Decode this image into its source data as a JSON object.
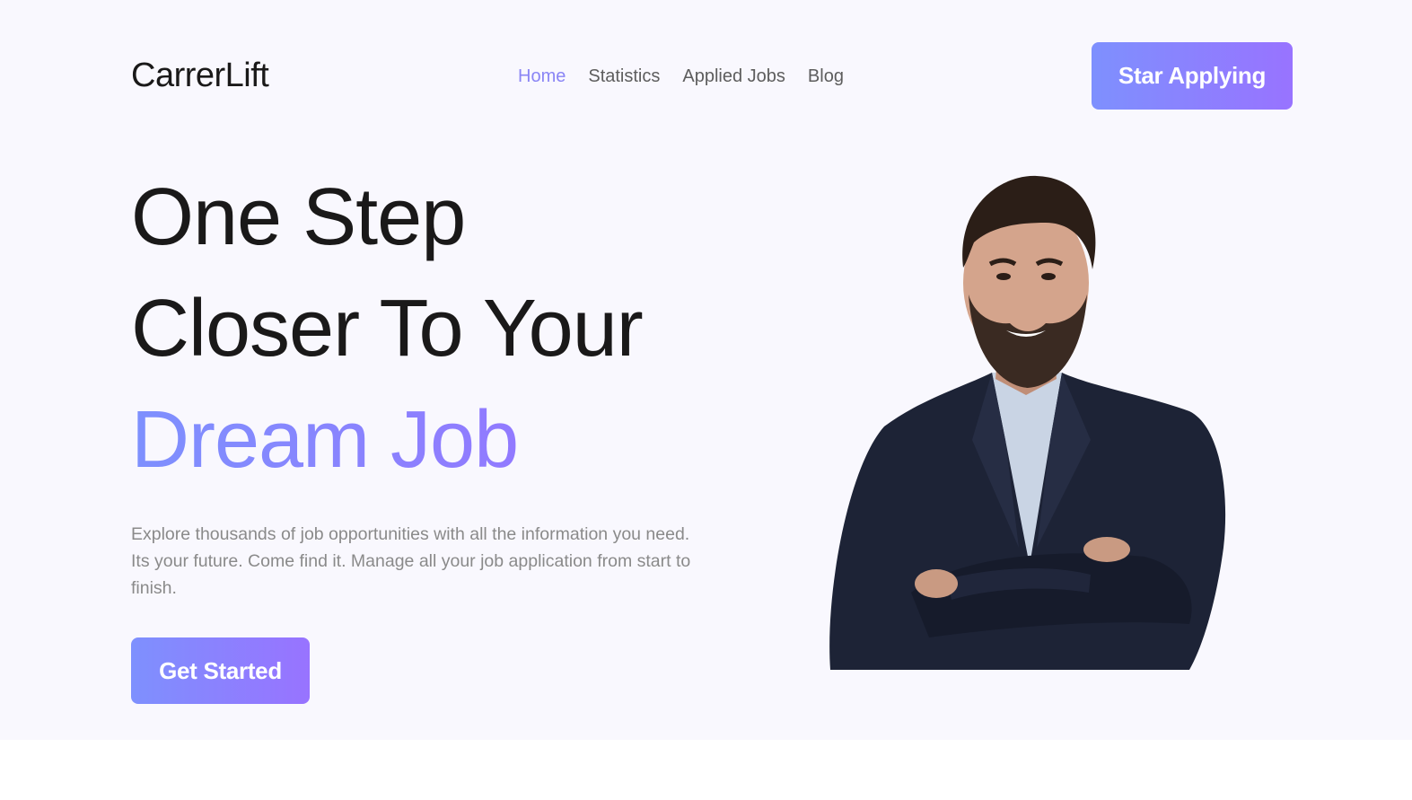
{
  "brand": {
    "name": "CarrerLift"
  },
  "nav": {
    "items": [
      {
        "label": "Home",
        "active": true
      },
      {
        "label": "Statistics",
        "active": false
      },
      {
        "label": "Applied Jobs",
        "active": false
      },
      {
        "label": "Blog",
        "active": false
      }
    ],
    "cta_label": "Star Applying"
  },
  "hero": {
    "headline_line1": "One Step",
    "headline_line2": "Closer To Your",
    "headline_accent": "Dream Job",
    "description": "Explore thousands of job opportunities with all the information you need. Its your future. Come find it. Manage all your job application from start to finish.",
    "cta_label": "Get Started",
    "image_alt": "Smiling man in dark blazer with crossed arms"
  },
  "colors": {
    "accent": "#8a85f5",
    "gradient_start": "#7e90fe",
    "gradient_end": "#9873ff",
    "heading": "#1a1919",
    "nav_text": "#5d5d5d",
    "body_text": "#8a8a8a",
    "hero_bg": "#f9f8fe"
  }
}
